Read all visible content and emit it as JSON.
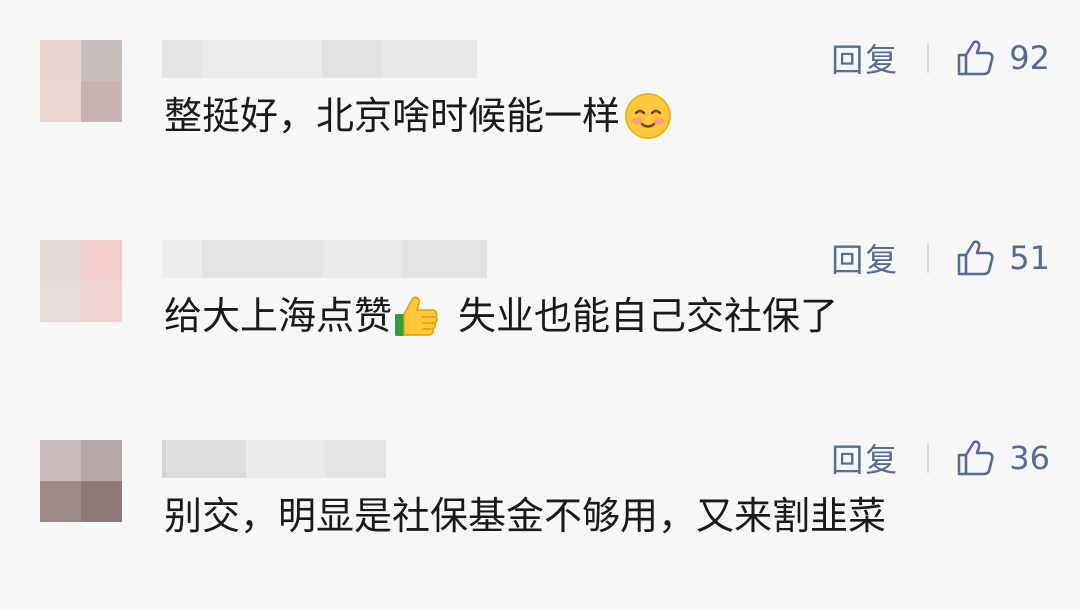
{
  "comments": [
    {
      "reply_label": "回复",
      "like_count": "92",
      "text": "整挺好，北京啥时候能一样",
      "emoji": "blush-smile-emoji",
      "avatar_colors": [
        "#e8d2cc",
        "#c9bfbd",
        "#ead6cf",
        "#c6b4b0"
      ],
      "nick_colors": [
        "#e6e6e6",
        "#ececec",
        "#e2e2e2",
        "#e9e9e9"
      ]
    },
    {
      "reply_label": "回复",
      "like_count": "51",
      "text_before": "给大上海点赞",
      "emoji": "thumbs-up-emoji",
      "text_after": "失业也能自己交社保了",
      "avatar_colors": [
        "#e2d9d7",
        "#f0cdc9",
        "#e6dcd9",
        "#eed3cf"
      ],
      "nick_colors": [
        "#eeeeee",
        "#e3e3e3",
        "#ebebeb",
        "#e4e4e4"
      ]
    },
    {
      "reply_label": "回复",
      "like_count": "36",
      "text": "别交，明显是社保基金不够用，又来割韭菜",
      "avatar_colors": [
        "#c7b9b9",
        "#b3a6a6",
        "#9c8a87",
        "#8c7978"
      ],
      "nick_colors": [
        "#e7e7e7",
        "#dedede",
        "#ebebeb",
        "#e3e3e3"
      ]
    }
  ],
  "icons": {
    "like": "thumbs-up-outline-icon"
  },
  "colors": {
    "background": "#f7f7f7",
    "link": "#576b95",
    "text": "#1a1a1a"
  }
}
